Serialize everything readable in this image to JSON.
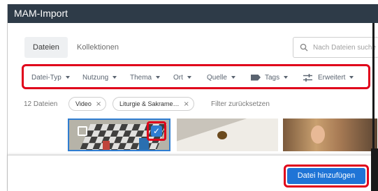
{
  "window": {
    "title": "MAM-Import"
  },
  "tabs": [
    {
      "label": "Dateien",
      "active": true
    },
    {
      "label": "Kollektionen",
      "active": false
    }
  ],
  "search": {
    "placeholder": "Nach Dateien suche",
    "value": ""
  },
  "filters": [
    {
      "label": "Datei-Typ",
      "icon": null
    },
    {
      "label": "Nutzung",
      "icon": null
    },
    {
      "label": "Thema",
      "icon": null
    },
    {
      "label": "Ort",
      "icon": null
    },
    {
      "label": "Quelle",
      "icon": null
    },
    {
      "label": "Tags",
      "icon": "tag-icon"
    },
    {
      "label": "Erweitert",
      "icon": "sliders-icon"
    }
  ],
  "results": {
    "count_label": "12 Dateien",
    "active_filters": [
      {
        "label": "Video"
      },
      {
        "label": "Liturgie & Sakrame…"
      }
    ],
    "reset_label": "Filter zurücksetzen"
  },
  "thumbnails": [
    {
      "selected": true,
      "icon": "edit-icon"
    },
    {
      "selected": false
    },
    {
      "selected": false
    }
  ],
  "footer": {
    "add_button_label": "Datei hinzufügen"
  },
  "colors": {
    "titlebar": "#2e3b48",
    "accent": "#1f74d6",
    "highlight_outline": "#e0001a"
  }
}
